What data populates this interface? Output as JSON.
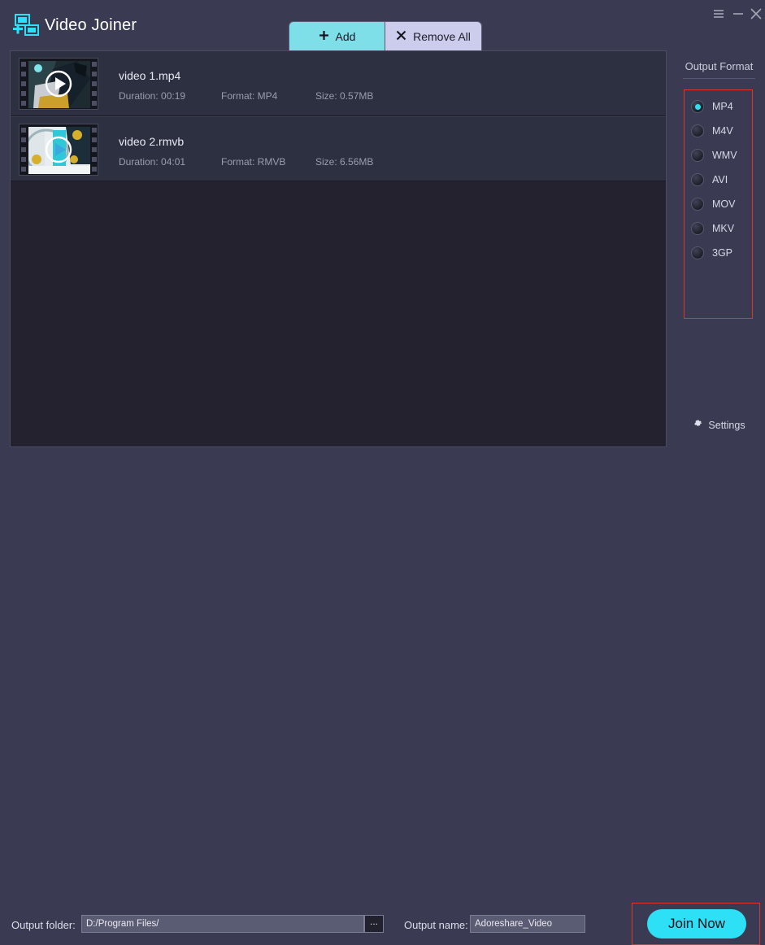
{
  "window": {
    "app_title": "Video Joiner",
    "logo_icon": "video-join-icon",
    "controls": [
      {
        "name": "menu",
        "icon": "hamburger-menu-icon"
      },
      {
        "name": "minimize",
        "icon": "minimize-icon"
      },
      {
        "name": "close",
        "icon": "close-icon"
      }
    ]
  },
  "toolbar": {
    "add_label": "Add",
    "add_icon": "plus-icon",
    "remove_all_label": "Remove All",
    "remove_all_icon": "x-icon"
  },
  "videos": [
    {
      "name": "video 1.mp4",
      "duration": "Duration: 00:19",
      "format": "Format: MP4",
      "size": "Size: 0.57MB"
    },
    {
      "name": "video 2.rmvb",
      "duration": "Duration: 04:01",
      "format": "Format: RMVB",
      "size": "Size: 6.56MB"
    }
  ],
  "sidebar": {
    "title": "Output Format",
    "formats": [
      {
        "label": "MP4",
        "selected": true
      },
      {
        "label": "M4V",
        "selected": false
      },
      {
        "label": "WMV",
        "selected": false
      },
      {
        "label": "AVI",
        "selected": false
      },
      {
        "label": "MOV",
        "selected": false
      },
      {
        "label": "MKV",
        "selected": false
      },
      {
        "label": "3GP",
        "selected": false
      }
    ],
    "settings_label": "Settings",
    "settings_icon": "gear-icon"
  },
  "footer": {
    "folder_label": "Output folder:",
    "folder_value": "D:/Program Files/",
    "browse_label": "...",
    "name_label": "Output name:",
    "name_value": "Adoreshare_Video",
    "join_label": "Join Now"
  },
  "colors": {
    "background": "#3a3b52",
    "list_background": "#23222e",
    "row_background": "#2d3040",
    "accent_cyan": "#2de0f5",
    "tab_add": "#7fdfe8",
    "tab_remove": "#ccccec",
    "highlight_red": "#e0342c"
  }
}
